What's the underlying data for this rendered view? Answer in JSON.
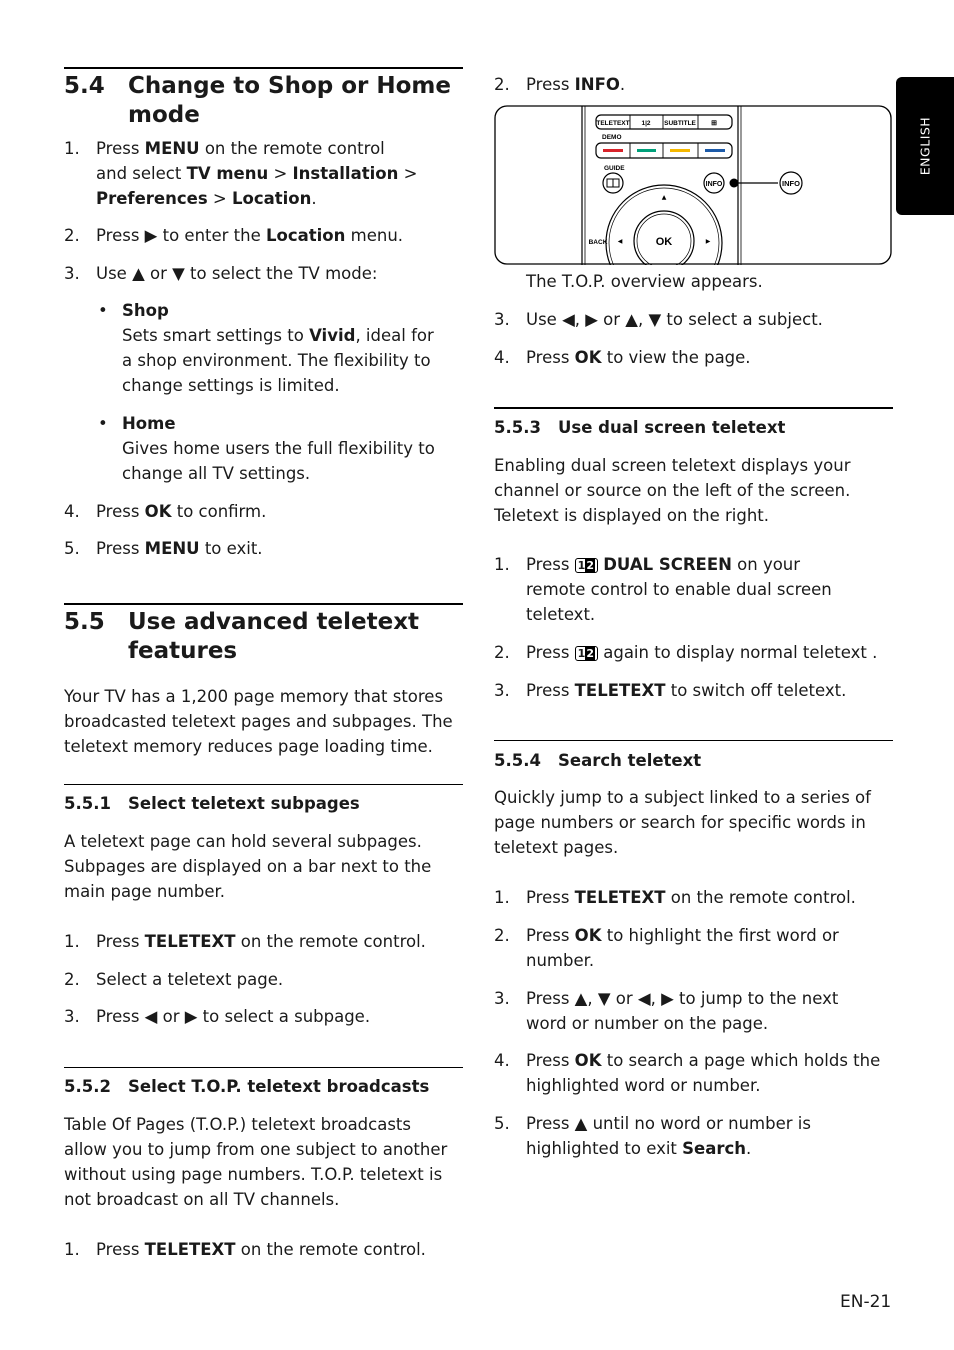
{
  "side_tab": "ENGLISH",
  "page_number": "EN-21",
  "s54": {
    "number": "5.4",
    "title": "Change to Shop or Home mode",
    "title_l1": "Change to Shop or Home",
    "title_l2": "mode",
    "steps": [
      {
        "n": "1.",
        "lines": [
          "Press <b>MENU</b> on the remote control",
          "and select <b>TV menu</b> &gt; <b>Installation</b> &gt;",
          "<b>Preferences</b> &gt; <b>Location</b>."
        ]
      },
      {
        "n": "2.",
        "lines": [
          "Press ▶ to enter the <b>Location</b> menu."
        ]
      },
      {
        "n": "3.",
        "lines": [
          "Use ▲ or ▼ to select the TV mode:"
        ]
      },
      {
        "n": "4.",
        "lines": [
          "Press <b>OK</b> to confirm."
        ]
      },
      {
        "n": "5.",
        "lines": [
          "Press <b>MENU</b> to exit."
        ]
      }
    ],
    "options": [
      {
        "name": "Shop",
        "lines": [
          "Sets smart settings to <b>Vivid</b>, ideal for",
          "a shop environment. The flexibility to",
          "change settings is limited."
        ]
      },
      {
        "name": "Home",
        "lines": [
          "Gives home users the full flexibility to",
          "change all TV settings."
        ]
      }
    ]
  },
  "s55": {
    "number": "5.5",
    "title_l1": "Use advanced teletext",
    "title_l2": "features",
    "intro": [
      "Your TV has a 1,200 page memory that stores",
      "broadcasted teletext pages and subpages. The",
      "teletext memory reduces page loading time."
    ]
  },
  "s551": {
    "number": "5.5.1",
    "title": "Select teletext subpages",
    "intro": [
      "A teletext page can hold several subpages.",
      "Subpages are displayed on a bar next to the",
      "main page number."
    ],
    "steps": [
      {
        "n": "1.",
        "lines": [
          "Press <b>TELETEXT</b> on the remote control."
        ]
      },
      {
        "n": "2.",
        "lines": [
          "Select a teletext page."
        ]
      },
      {
        "n": "3.",
        "lines": [
          "Press ◀ or ▶ to select a subpage."
        ]
      }
    ]
  },
  "s552": {
    "number": "5.5.2",
    "title": "Select T.O.P. teletext broadcasts",
    "intro": [
      "Table Of Pages (T.O.P.) teletext broadcasts",
      "allow you to jump from one subject to another",
      "without using page numbers. T.O.P. teletext is",
      "not broadcast on all TV channels."
    ],
    "steps": [
      {
        "n": "1.",
        "lines": [
          "Press <b>TELETEXT</b> on the remote control."
        ]
      },
      {
        "n": "2.",
        "lines": [
          "Press <b>INFO</b>."
        ]
      },
      {
        "n": "",
        "lines": [
          "The T.O.P. overview appears."
        ]
      },
      {
        "n": "3.",
        "lines": [
          "Use ◀, ▶ or ▲, ▼ to select a subject."
        ]
      },
      {
        "n": "4.",
        "lines": [
          "Press <b>OK</b> to view the page."
        ]
      }
    ]
  },
  "remote": {
    "top_buttons": [
      "TELETEXT",
      "1|2",
      "SUBTITLE",
      "⊞"
    ],
    "demo_label": "DEMO",
    "color_keys": [
      "#d8232a",
      "#00a07a",
      "#f5b800",
      "#1c5aa8"
    ],
    "guide_label": "GUIDE",
    "info_label": "INFO",
    "callout_label": "INFO",
    "ok_label": "OK",
    "back_label": "BACK"
  },
  "s553": {
    "number": "5.5.3",
    "title": "Use dual screen teletext",
    "intro": [
      "Enabling dual screen teletext displays your",
      "channel or source on the left of the screen.",
      "Teletext is displayed on the right."
    ],
    "steps": [
      {
        "n": "1.",
        "lines": [
          "Press <span class=\"dual\"><span>1</span><span>2</span></span> <b>DUAL SCREEN</b> on your",
          "remote control to enable dual screen",
          "teletext."
        ]
      },
      {
        "n": "2.",
        "lines": [
          "Press <span class=\"dual\"><span>1</span><span>2</span></span> again to display normal teletext ."
        ]
      },
      {
        "n": "3.",
        "lines": [
          "Press <b>TELETEXT</b> to switch off teletext."
        ]
      }
    ]
  },
  "s554": {
    "number": "5.5.4",
    "title": "Search teletext",
    "intro": [
      "Quickly jump to a subject linked to a series of",
      "page numbers or search for specific words in",
      "teletext pages."
    ],
    "steps": [
      {
        "n": "1.",
        "lines": [
          "Press <b>TELETEXT</b> on the remote control."
        ]
      },
      {
        "n": "2.",
        "lines": [
          "Press <b>OK</b> to highlight the first word or",
          "number."
        ]
      },
      {
        "n": "3.",
        "lines": [
          "Press ▲, ▼ or ◀, ▶ to jump to the next",
          "word or number on the page."
        ]
      },
      {
        "n": "4.",
        "lines": [
          "Press <b>OK</b> to search a page which holds the",
          "highlighted word or number."
        ]
      },
      {
        "n": "5.",
        "lines": [
          "Press ▲ until no word or number is",
          "highlighted to exit <b>Search</b>."
        ]
      }
    ]
  }
}
